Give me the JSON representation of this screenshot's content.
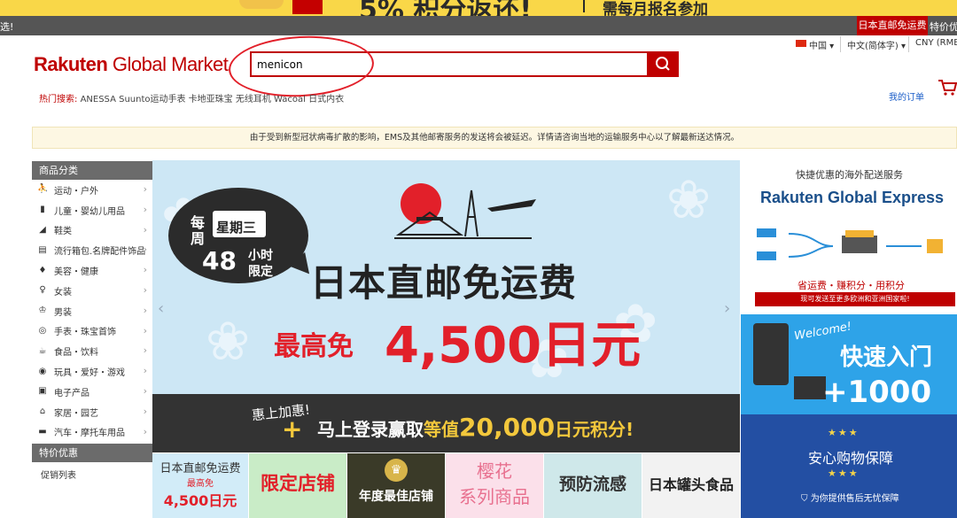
{
  "promo": {
    "headline": "5% 积分返还!",
    "right": "需每月报名参加"
  },
  "topnav": {
    "left": "选!",
    "japan_btn": "日本直邮免运费",
    "deals": "特价优"
  },
  "locale": {
    "country": "中国",
    "language": "中文(简体字)",
    "currency": "CNY (RMB"
  },
  "header": {
    "logo_rakuten": "Rakuten",
    "logo_rest": " Global Market",
    "search": {
      "value": "menicon"
    },
    "hot_label": "热门搜索:",
    "hot_terms": "ANESSA  Suunto运动手表  卡地亚珠宝  无线耳机  Wacoal 日式内衣",
    "my_orders": "我的订单"
  },
  "notice": "由于受到新型冠状病毒扩散的影响，EMS及其他邮寄服务的发送将会被延迟。详情请咨询当地的运输服务中心以了解最新送达情况。",
  "sidebar": {
    "title": "商品分类",
    "items": [
      {
        "label": "运动・户外",
        "icon": "bike-icon",
        "glyph": "⛹"
      },
      {
        "label": "儿童・婴幼儿用品",
        "icon": "baby-bottle-icon",
        "glyph": "▮"
      },
      {
        "label": "鞋类",
        "icon": "shoe-icon",
        "glyph": "◢"
      },
      {
        "label": "流行箱包.名牌配件饰品",
        "icon": "bag-icon",
        "glyph": "▤"
      },
      {
        "label": "美容・健康",
        "icon": "perfume-icon",
        "glyph": "♦"
      },
      {
        "label": "女装",
        "icon": "dress-icon",
        "glyph": "♀"
      },
      {
        "label": "男装",
        "icon": "shirt-icon",
        "glyph": "♔"
      },
      {
        "label": "手表・珠宝首饰",
        "icon": "watch-icon",
        "glyph": "◎"
      },
      {
        "label": "食品・饮料",
        "icon": "food-icon",
        "glyph": "☕"
      },
      {
        "label": "玩具・爱好・游戏",
        "icon": "gamepad-icon",
        "glyph": "◉"
      },
      {
        "label": "电子产品",
        "icon": "camera-icon",
        "glyph": "▣"
      },
      {
        "label": "家居・园艺",
        "icon": "home-icon",
        "glyph": "⌂"
      },
      {
        "label": "汽车・摩托车用品",
        "icon": "car-icon",
        "glyph": "▬"
      }
    ],
    "deals_title": "特价优惠",
    "deals_item": "促销列表"
  },
  "banner": {
    "bubble_week1": "每",
    "bubble_week2": "周",
    "bubble_day": "星期三",
    "bubble_hours": "48",
    "bubble_unit": "小时",
    "bubble_limit": "限定",
    "title": "日本直邮免运费",
    "sub_prefix": "最高免",
    "sub_amount": "4,500日元"
  },
  "strip": {
    "line1": "惠上加惠!",
    "plus": "+",
    "line2_a": "马上登录赢取",
    "line2_b": "等值",
    "line2_amount": "20,000",
    "line2_c": "日元积分!"
  },
  "tiles": [
    {
      "l1": "日本直邮免运费",
      "l2": "最高免",
      "l3": "4,500日元"
    },
    {
      "l1": "限定店铺"
    },
    {
      "l1": "年度最佳店铺"
    },
    {
      "l1": "樱花",
      "l2": "系列商品"
    },
    {
      "l1": "预防流感"
    },
    {
      "l1": "日本罐头食品"
    }
  ],
  "right": {
    "express_title": "快捷优惠的海外配送服务",
    "express_brand": "Rakuten Global Express",
    "express_tag": "省运费・赚积分・用积分",
    "express_red": "现可发送至更多欧洲和亚洲国家啦!",
    "welcome": "Welcome!",
    "welcome_title": "快速入门",
    "welcome_points": "+1000",
    "safe_title": "安心购物保障",
    "safe_sub": "为你提供售后无忧保障"
  },
  "colors": {
    "brand": "#bf0000",
    "promo": "#f9d748",
    "banner_bg": "#cde7f5"
  }
}
